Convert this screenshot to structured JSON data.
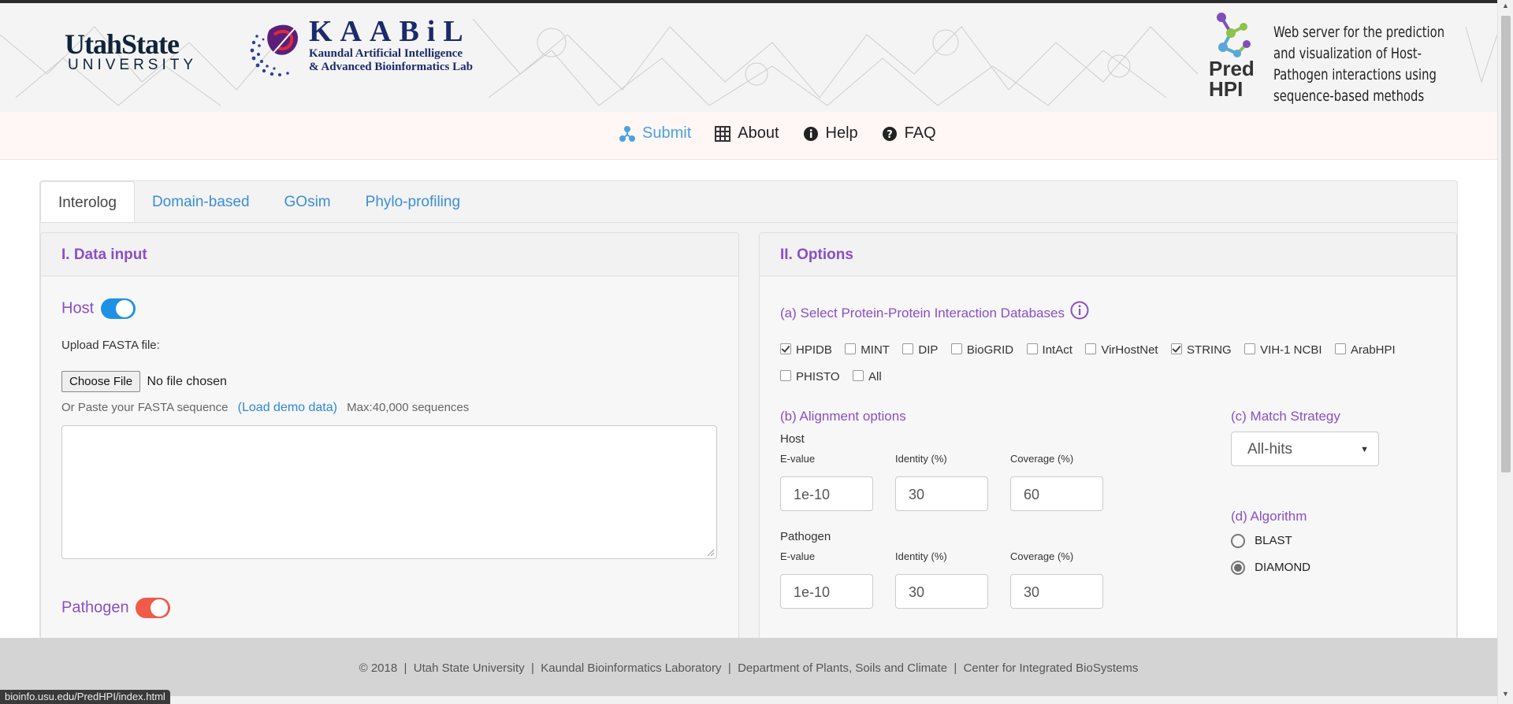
{
  "header": {
    "usu_line1": "UtahState",
    "usu_line2": "UNIVERSITY",
    "kaabil_title": "KAABiL",
    "kaabil_line2": "Kaundal Artificial Intelligence",
    "kaabil_line3": "& Advanced Bioinformatics Lab",
    "predhpi_line1": "Pred",
    "predhpi_line2": "HPI",
    "tagline": "Web server for the prediction and visualization of Host-Pathogen interactions using sequence-based methods"
  },
  "nav": {
    "items": [
      {
        "label": "Submit",
        "icon": "network-icon",
        "active": true
      },
      {
        "label": "About",
        "icon": "grid-icon"
      },
      {
        "label": "Help",
        "icon": "info-icon"
      },
      {
        "label": "FAQ",
        "icon": "question-icon"
      }
    ]
  },
  "tabs": [
    "Interolog",
    "Domain-based",
    "GOsim",
    "Phylo-profiling"
  ],
  "data_input": {
    "heading": "I. Data input",
    "host_label": "Host",
    "upload_label": "Upload FASTA file:",
    "choose_file": "Choose File",
    "no_file": "No file chosen",
    "paste_label": "Or Paste your FASTA sequence",
    "demo_link": "(Load demo data)",
    "max_note": "Max:40,000 sequences",
    "pathogen_label": "Pathogen",
    "host_toggle_on": true,
    "pathogen_toggle_on": true
  },
  "options": {
    "heading": "II. Options",
    "ppi_heading": "(a) Select Protein-Protein Interaction Databases",
    "databases": [
      {
        "name": "HPIDB",
        "checked": true
      },
      {
        "name": "MINT",
        "checked": false
      },
      {
        "name": "DIP",
        "checked": false
      },
      {
        "name": "BioGRID",
        "checked": false
      },
      {
        "name": "IntAct",
        "checked": false
      },
      {
        "name": "VirHostNet",
        "checked": false
      },
      {
        "name": "STRING",
        "checked": true
      },
      {
        "name": "VIH-1 NCBI",
        "checked": false
      },
      {
        "name": "ArabHPI",
        "checked": false
      },
      {
        "name": "PHISTO",
        "checked": false
      },
      {
        "name": "All",
        "checked": false
      }
    ],
    "alignment_heading": "(b) Alignment options",
    "host_label": "Host",
    "pathogen_label": "Pathogen",
    "evalue_label": "E-value",
    "identity_label": "Identity (%)",
    "coverage_label": "Coverage (%)",
    "host_values": {
      "evalue": "1e-10",
      "identity": "30",
      "coverage": "60"
    },
    "pathogen_values": {
      "evalue": "1e-10",
      "identity": "30",
      "coverage": "30"
    },
    "match_heading": "(c) Match Strategy",
    "match_value": "All-hits",
    "algorithm_heading": "(d) Algorithm",
    "algorithms": [
      {
        "name": "BLAST",
        "selected": false
      },
      {
        "name": "DIAMOND",
        "selected": true
      }
    ]
  },
  "footer": {
    "text": "© 2018  |  Utah State University  |  Kaundal Bioinformatics Laboratory  |  Department of Plants, Soils and Climate  |  Center for Integrated BioSystems"
  },
  "status_url": "bioinfo.usu.edu/PredHPI/index.html",
  "colors": {
    "accent_purple": "#8a4fc6",
    "link_blue": "#2c8ad8",
    "toggle_blue": "#1e90e6",
    "toggle_red": "#f05a48"
  }
}
